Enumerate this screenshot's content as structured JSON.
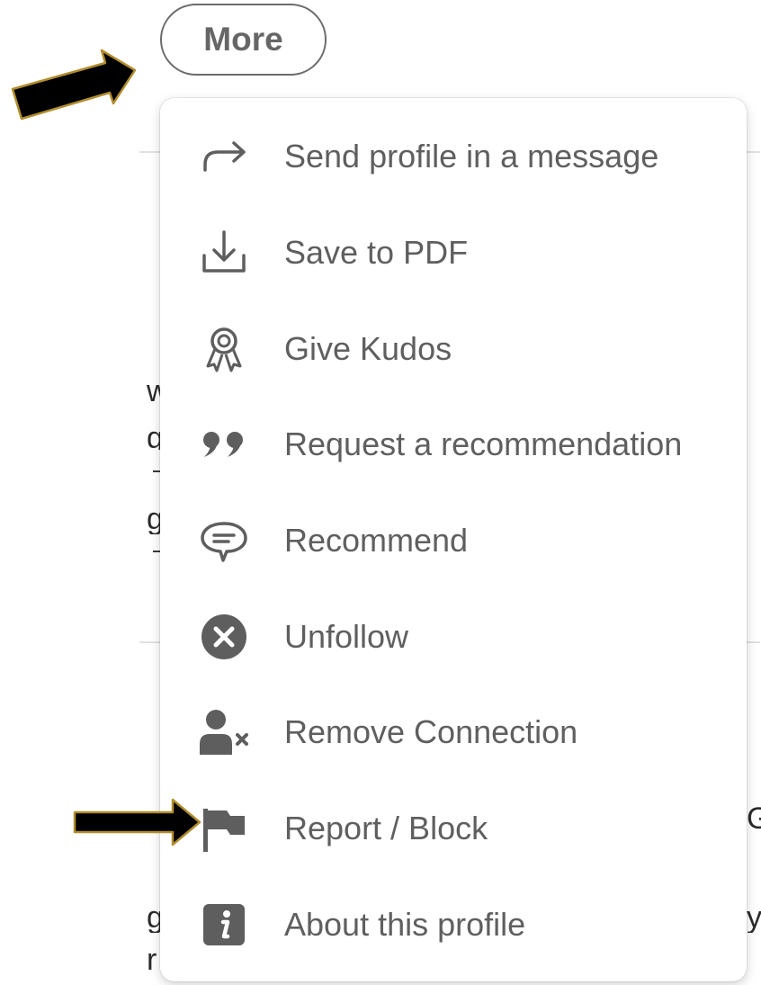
{
  "more_button": {
    "label": "More"
  },
  "menu": {
    "items": [
      {
        "label": "Send profile in a message",
        "icon": "share-arrow-icon"
      },
      {
        "label": "Save to PDF",
        "icon": "download-icon"
      },
      {
        "label": "Give Kudos",
        "icon": "award-ribbon-icon"
      },
      {
        "label": "Request a recommendation",
        "icon": "quote-icon"
      },
      {
        "label": "Recommend",
        "icon": "speech-bubble-icon"
      },
      {
        "label": "Unfollow",
        "icon": "close-circle-icon"
      },
      {
        "label": "Remove Connection",
        "icon": "remove-person-icon"
      },
      {
        "label": "Report / Block",
        "icon": "flag-icon"
      },
      {
        "label": "About this profile",
        "icon": "info-icon"
      }
    ]
  },
  "colors": {
    "text": "#5f5f5f",
    "icon": "#5e5e5e",
    "arrow_fill": "#000000",
    "arrow_outline": "#b08d2e"
  }
}
